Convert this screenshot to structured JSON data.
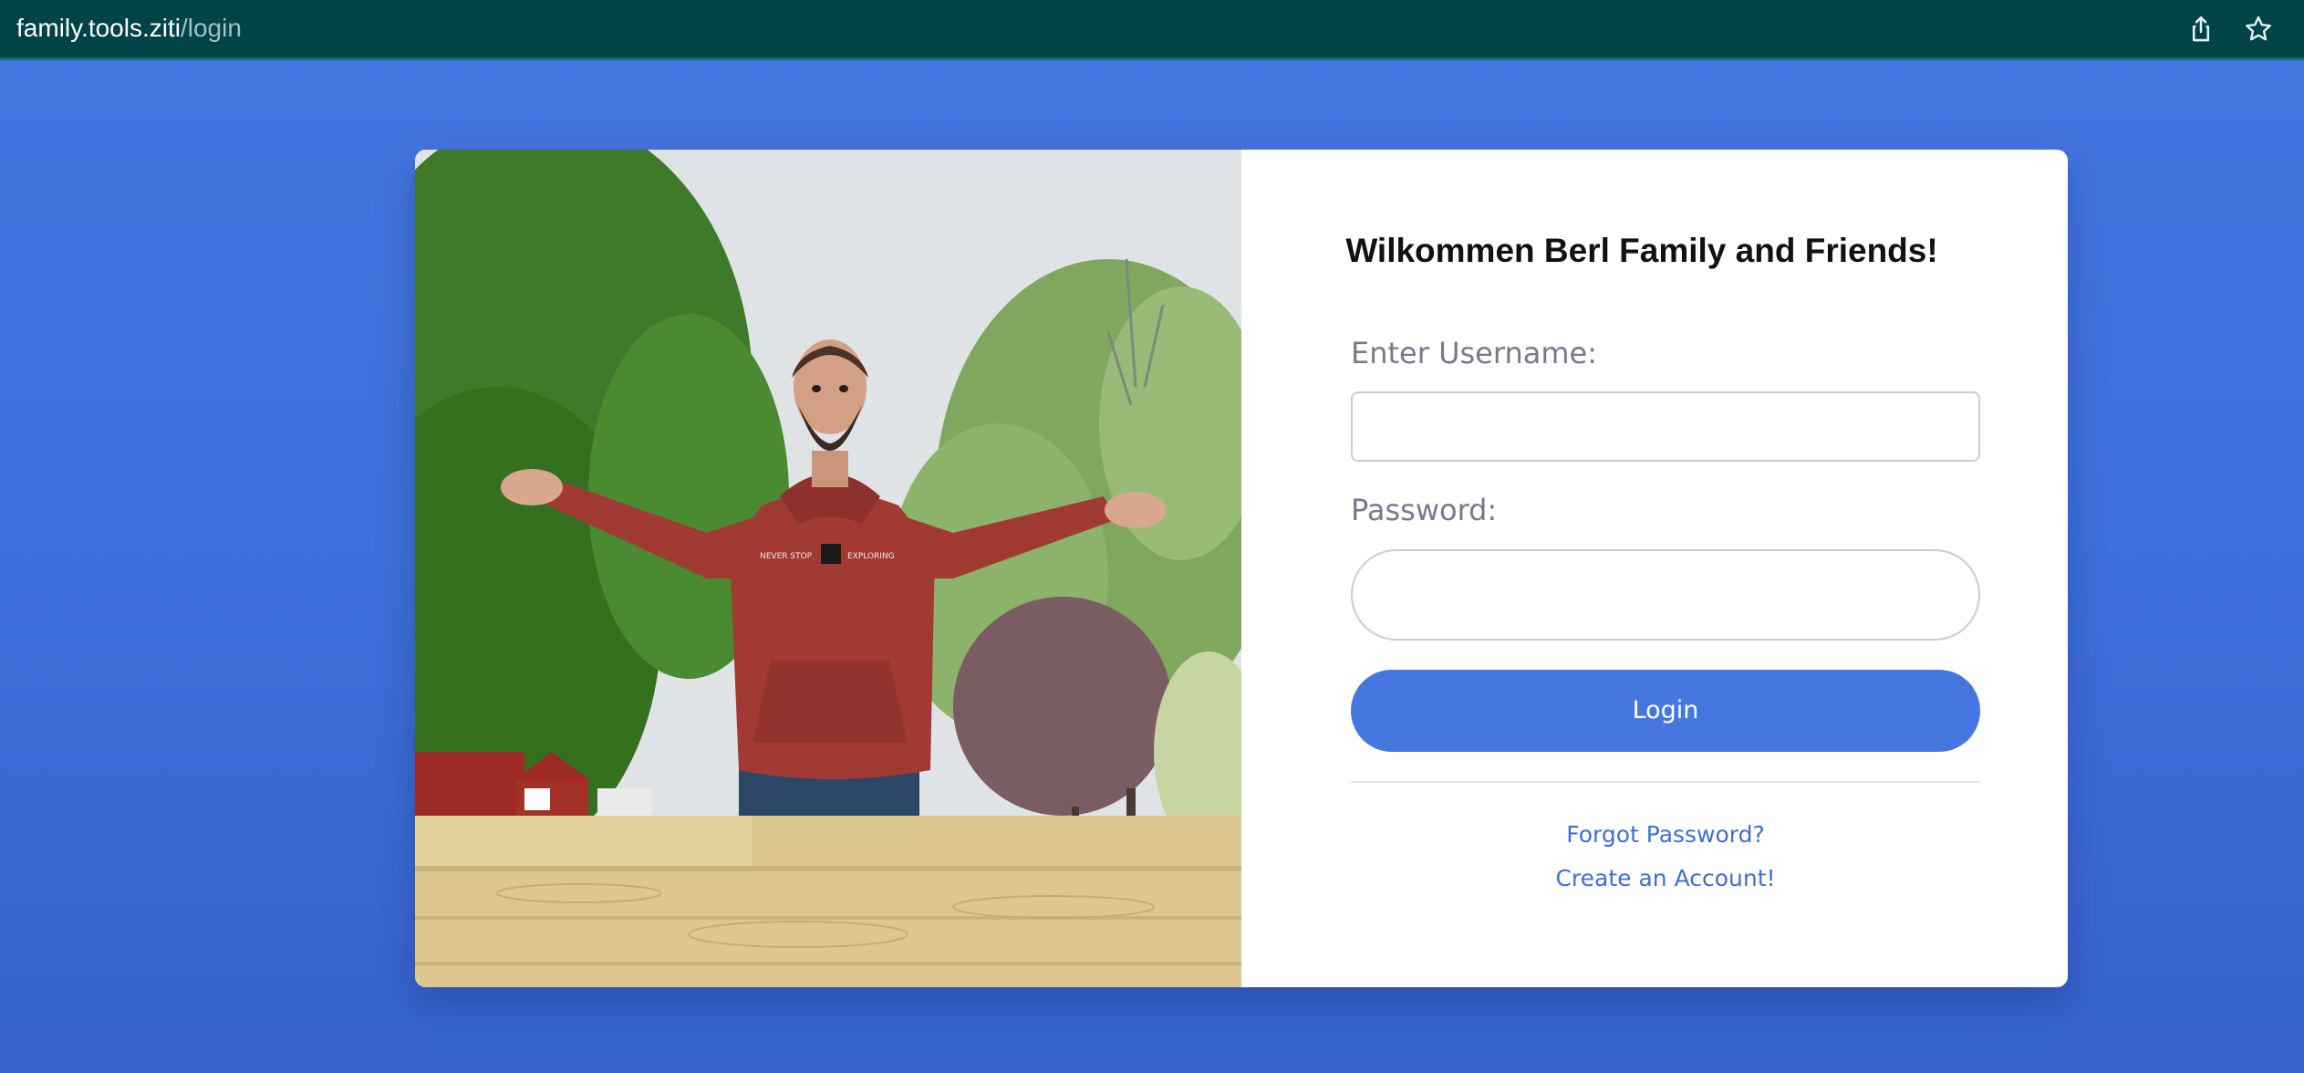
{
  "browser": {
    "url_host": "family.tools.ziti",
    "url_path": "/login",
    "icons": [
      "share-icon",
      "star-icon"
    ]
  },
  "login_form": {
    "title": "Wilkommen Berl Family and Friends!",
    "username_label": "Enter Username:",
    "username_value": "",
    "password_label": "Password:",
    "password_value": "",
    "login_button": "Login",
    "forgot_password": "Forgot Password?",
    "create_account": "Create an Account!"
  },
  "hoodie_print": {
    "left": "NEVER STOP",
    "right": "EXPLORING"
  },
  "colors": {
    "background": "#4676e0",
    "topbar": "#004448",
    "primary_button": "#4676e0",
    "link": "#3e6fd6",
    "title": "#111111",
    "label": "#767a8c"
  }
}
